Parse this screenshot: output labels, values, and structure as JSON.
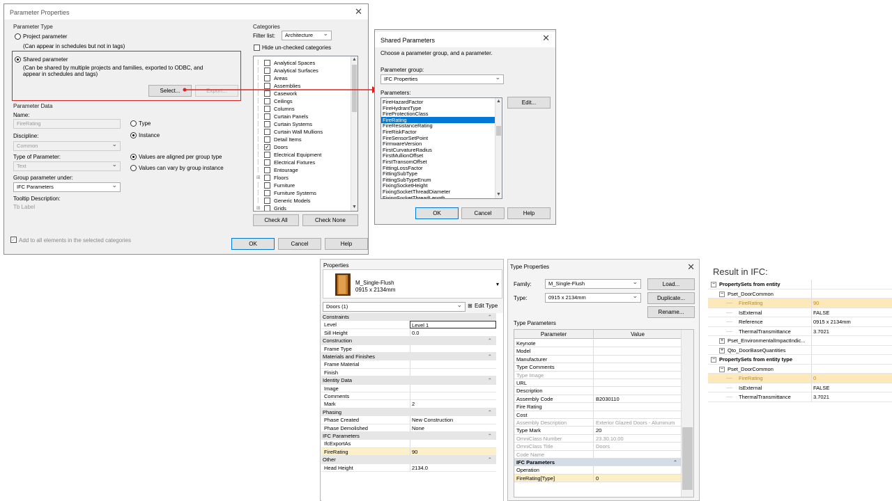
{
  "param_props": {
    "title": "Parameter Properties",
    "type_group": "Parameter Type",
    "project_param": "Project parameter",
    "project_note": "(Can appear in schedules but not in tags)",
    "shared_param": "Shared parameter",
    "shared_note1": "(Can be shared by multiple projects and families, exported to ODBC, and",
    "shared_note2": "appear in schedules and tags)",
    "select_btn": "Select...",
    "export_btn": "Export...",
    "data_group": "Parameter Data",
    "name_label": "Name:",
    "name_value": "FireRating",
    "type_radio": "Type",
    "instance_radio": "Instance",
    "discipline_label": "Discipline:",
    "discipline_value": "Common",
    "type_of_param_label": "Type of Parameter:",
    "type_of_param_value": "Text",
    "aligned_radio": "Values are aligned per group type",
    "vary_radio": "Values can vary by group instance",
    "group_under_label": "Group parameter under:",
    "group_under_value": "IFC Parameters",
    "tooltip_label": "Tooltip Description:",
    "tooltip_value": "Tb Label",
    "add_all": "Add to all elements in the selected categories",
    "ok": "OK",
    "cancel": "Cancel",
    "help": "Help",
    "categories_group": "Categories",
    "filter_label": "Filter list:",
    "filter_value": "Architecture",
    "hide_unchecked": "Hide un-checked categories",
    "categories": [
      "Analytical Spaces",
      "Analytical Surfaces",
      "Areas",
      "Assemblies",
      "Casework",
      "Ceilings",
      "Columns",
      "Curtain Panels",
      "Curtain Systems",
      "Curtain Wall Mullions",
      "Detail Items",
      "Doors",
      "Electrical Equipment",
      "Electrical Fixtures",
      "Entourage",
      "Floors",
      "Furniture",
      "Furniture Systems",
      "Generic Models",
      "Grids"
    ],
    "check_all": "Check All",
    "check_none": "Check None"
  },
  "shared_params": {
    "title": "Shared Parameters",
    "instruction": "Choose a parameter group, and a parameter.",
    "group_label": "Parameter group:",
    "group_value": "IFC Properties",
    "params_label": "Parameters:",
    "params": [
      "FireHazardFactor",
      "FireHydrantType",
      "FireProtectionClass",
      "FireRating",
      "FireResistanceRating",
      "FireRiskFactor",
      "FireSensorSetPoint",
      "FirmwareVersion",
      "FirstCurvatureRadius",
      "FirstMullionOffset",
      "FirstTransomOffset",
      "FittingLossFactor",
      "FittingSubType",
      "FittingSubTypeEnum",
      "FixingSocketHeight",
      "FixingSocketThreadDiameter",
      "FixingSocketThreadLength"
    ],
    "edit_btn": "Edit...",
    "ok": "OK",
    "cancel": "Cancel",
    "help": "Help"
  },
  "properties": {
    "title": "Properties",
    "family": "M_Single-Flush",
    "size": "0915 x 2134mm",
    "selector": "Doors (1)",
    "edit_type": "Edit Type",
    "rows": [
      {
        "k": "Constraints",
        "v": "",
        "sec": true
      },
      {
        "k": "Level",
        "v": "Level 1"
      },
      {
        "k": "Sill Height",
        "v": "0.0"
      },
      {
        "k": "Construction",
        "v": "",
        "sec": true
      },
      {
        "k": "Frame Type",
        "v": ""
      },
      {
        "k": "Materials and Finishes",
        "v": "",
        "sec": true
      },
      {
        "k": "Frame Material",
        "v": ""
      },
      {
        "k": "Finish",
        "v": ""
      },
      {
        "k": "Identity Data",
        "v": "",
        "sec": true
      },
      {
        "k": "Image",
        "v": ""
      },
      {
        "k": "Comments",
        "v": ""
      },
      {
        "k": "Mark",
        "v": "2"
      },
      {
        "k": "Phasing",
        "v": "",
        "sec": true
      },
      {
        "k": "Phase Created",
        "v": "New Construction"
      },
      {
        "k": "Phase Demolished",
        "v": "None"
      },
      {
        "k": "IFC Parameters",
        "v": "",
        "sec": true
      },
      {
        "k": "IfcExportAs",
        "v": ""
      },
      {
        "k": "FireRating",
        "v": "90",
        "hl": true
      },
      {
        "k": "Other",
        "v": "",
        "sec": true
      },
      {
        "k": "Head Height",
        "v": "2134.0"
      }
    ]
  },
  "type_props": {
    "title": "Type Properties",
    "family_label": "Family:",
    "family_value": "M_Single-Flush",
    "type_label": "Type:",
    "type_value": "0915 x 2134mm",
    "load_btn": "Load...",
    "duplicate_btn": "Duplicate...",
    "rename_btn": "Rename...",
    "type_params": "Type Parameters",
    "col_param": "Parameter",
    "col_value": "Value",
    "rows": [
      {
        "k": "Keynote",
        "v": ""
      },
      {
        "k": "Model",
        "v": ""
      },
      {
        "k": "Manufacturer",
        "v": ""
      },
      {
        "k": "Type Comments",
        "v": ""
      },
      {
        "k": "Type Image",
        "v": "",
        "dis": true
      },
      {
        "k": "URL",
        "v": ""
      },
      {
        "k": "Description",
        "v": ""
      },
      {
        "k": "Assembly Code",
        "v": "B2030110"
      },
      {
        "k": "Fire Rating",
        "v": ""
      },
      {
        "k": "Cost",
        "v": ""
      },
      {
        "k": "Assembly Description",
        "v": "Exterior Glazed Doors - Aluminum",
        "dis": true
      },
      {
        "k": "Type Mark",
        "v": "20"
      },
      {
        "k": "OmniClass Number",
        "v": "23.30.10.00",
        "dis": true
      },
      {
        "k": "OmniClass Title",
        "v": "Doors",
        "dis": true
      },
      {
        "k": "Code Name",
        "v": "",
        "dis": true
      },
      {
        "k": "IFC Parameters",
        "v": "",
        "sec": true
      },
      {
        "k": "Operation",
        "v": ""
      },
      {
        "k": "FireRating[Type]",
        "v": "0",
        "hl": true
      }
    ]
  },
  "ifc": {
    "title": "Result in IFC:",
    "rows": [
      {
        "k": "PropertySets from entity",
        "v": "",
        "lvl": 0,
        "bold": true,
        "exp": "−"
      },
      {
        "k": "Pset_DoorCommon",
        "v": "",
        "lvl": 1,
        "exp": "−"
      },
      {
        "k": "FireRating",
        "v": "90",
        "lvl": 2,
        "hl": true
      },
      {
        "k": "IsExternal",
        "v": "FALSE",
        "lvl": 2
      },
      {
        "k": "Reference",
        "v": "0915 x 2134mm",
        "lvl": 2
      },
      {
        "k": "ThermalTransmittance",
        "v": "3.7021",
        "lvl": 2
      },
      {
        "k": "Pset_EnvironmentalImpactIndic...",
        "v": "",
        "lvl": 1,
        "exp": "+"
      },
      {
        "k": "Qto_DoorBaseQuantities",
        "v": "",
        "lvl": 1,
        "exp": "+"
      },
      {
        "k": "PropertySets from entity type",
        "v": "",
        "lvl": 0,
        "bold": true,
        "exp": "−"
      },
      {
        "k": "Pset_DoorCommon",
        "v": "",
        "lvl": 1,
        "exp": "−"
      },
      {
        "k": "FireRating",
        "v": "0",
        "lvl": 2,
        "hl": true
      },
      {
        "k": "IsExternal",
        "v": "FALSE",
        "lvl": 2
      },
      {
        "k": "ThermalTransmittance",
        "v": "3.7021",
        "lvl": 2
      }
    ]
  },
  "colors": {
    "highlight": "#0078d7",
    "annotation": "#e02020",
    "ifc_highlight": "#fce8b8"
  }
}
